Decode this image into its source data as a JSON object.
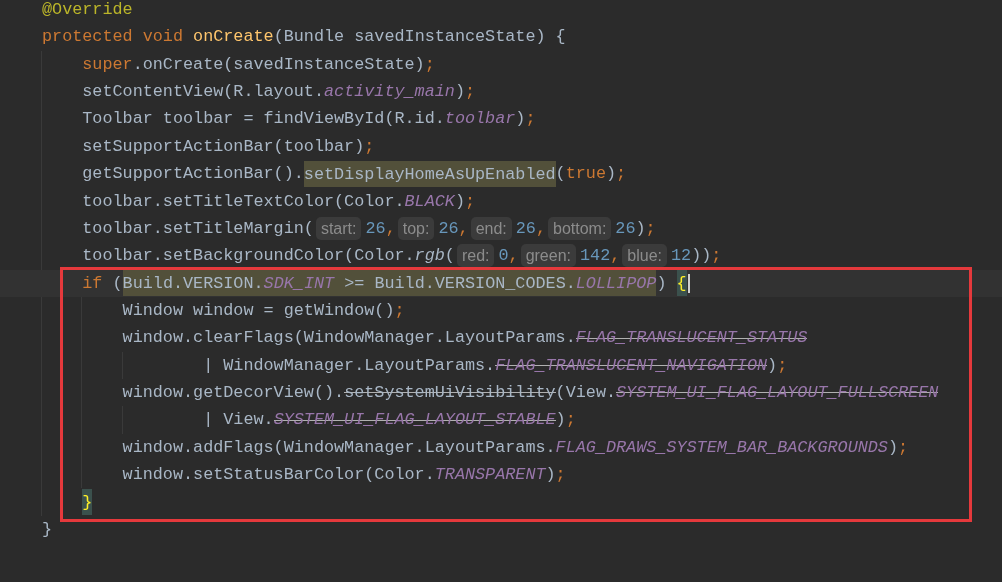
{
  "editor": {
    "lines": [
      {
        "kind": "code",
        "current": false,
        "tokens": [
          {
            "kind": "annotation",
            "text": "@Override"
          }
        ]
      },
      {
        "kind": "code",
        "current": false,
        "tokens": [
          {
            "kind": "keyword",
            "text": "protected void "
          },
          {
            "kind": "function",
            "text": "onCreate"
          },
          {
            "kind": "plain",
            "text": "(Bundle savedInstanceState) {"
          }
        ],
        "children": [
          {
            "kind": "code",
            "current": false,
            "tokens": [
              {
                "kind": "keyword",
                "text": "super"
              },
              {
                "kind": "plain",
                "text": ".onCreate(savedInstanceState)"
              },
              {
                "kind": "punct",
                "text": ";"
              }
            ]
          },
          {
            "kind": "code",
            "current": false,
            "tokens": [
              {
                "kind": "plain",
                "text": "setContentView(R.layout."
              },
              {
                "kind": "field",
                "text": "activity_main"
              },
              {
                "kind": "plain",
                "text": ")"
              },
              {
                "kind": "punct",
                "text": ";"
              }
            ]
          },
          {
            "kind": "code",
            "current": false,
            "tokens": [
              {
                "kind": "plain",
                "text": "Toolbar toolbar = findViewById(R.id."
              },
              {
                "kind": "field",
                "text": "toolbar"
              },
              {
                "kind": "plain",
                "text": ")"
              },
              {
                "kind": "punct",
                "text": ";"
              }
            ]
          },
          {
            "kind": "code",
            "current": false,
            "tokens": [
              {
                "kind": "plain",
                "text": "setSupportActionBar(toolbar)"
              },
              {
                "kind": "punct",
                "text": ";"
              }
            ]
          },
          {
            "kind": "code",
            "current": false,
            "tokens": [
              {
                "kind": "plain",
                "text": "getSupportActionBar()."
              },
              {
                "kind": "highlight",
                "tokens": [
                  {
                    "kind": "plain",
                    "text": "setDisplayHomeAsUpEnabled"
                  }
                ]
              },
              {
                "kind": "plain",
                "text": "("
              },
              {
                "kind": "keyword",
                "text": "true"
              },
              {
                "kind": "plain",
                "text": ")"
              },
              {
                "kind": "punct",
                "text": ";"
              }
            ]
          },
          {
            "kind": "code",
            "current": false,
            "tokens": [
              {
                "kind": "plain",
                "text": "toolbar.setTitleTextColor(Color."
              },
              {
                "kind": "field",
                "text": "BLACK"
              },
              {
                "kind": "plain",
                "text": ")"
              },
              {
                "kind": "punct",
                "text": ";"
              }
            ]
          },
          {
            "kind": "code",
            "current": false,
            "tokens": [
              {
                "kind": "plain",
                "text": "toolbar.setTitleMargin("
              },
              {
                "kind": "hint",
                "text": "start:"
              },
              {
                "kind": "number",
                "text": "26"
              },
              {
                "kind": "punct",
                "text": ","
              },
              {
                "kind": "hint",
                "text": "top:"
              },
              {
                "kind": "number",
                "text": "26"
              },
              {
                "kind": "punct",
                "text": ","
              },
              {
                "kind": "hint",
                "text": "end:"
              },
              {
                "kind": "number",
                "text": "26"
              },
              {
                "kind": "punct",
                "text": ","
              },
              {
                "kind": "hint",
                "text": "bottom:"
              },
              {
                "kind": "number",
                "text": "26"
              },
              {
                "kind": "plain",
                "text": ")"
              },
              {
                "kind": "punct",
                "text": ";"
              }
            ]
          },
          {
            "kind": "code",
            "current": false,
            "tokens": [
              {
                "kind": "plain",
                "text": "toolbar.setBackgroundColor(Color."
              },
              {
                "kind": "static_call",
                "text": "rgb"
              },
              {
                "kind": "plain",
                "text": "("
              },
              {
                "kind": "hint",
                "text": "red:"
              },
              {
                "kind": "number",
                "text": "0"
              },
              {
                "kind": "punct",
                "text": ","
              },
              {
                "kind": "hint",
                "text": "green:"
              },
              {
                "kind": "number",
                "text": "142"
              },
              {
                "kind": "punct",
                "text": ","
              },
              {
                "kind": "hint",
                "text": "blue:"
              },
              {
                "kind": "number",
                "text": "12"
              },
              {
                "kind": "plain",
                "text": "))"
              },
              {
                "kind": "punct",
                "text": ";"
              }
            ]
          },
          {
            "kind": "frame",
            "lines": [
              {
                "kind": "code",
                "current": true,
                "tokens": [
                  {
                    "kind": "keyword",
                    "text": "if"
                  },
                  {
                    "kind": "plain",
                    "text": " ("
                  },
                  {
                    "kind": "highlight",
                    "tokens": [
                      {
                        "kind": "plain",
                        "text": "Build.VERSION."
                      },
                      {
                        "kind": "field",
                        "text": "SDK_INT"
                      },
                      {
                        "kind": "plain",
                        "text": " >= Build.VERSION_CODES."
                      },
                      {
                        "kind": "field",
                        "text": "LOLLIPOP"
                      }
                    ]
                  },
                  {
                    "kind": "plain",
                    "text": ") "
                  },
                  {
                    "kind": "brace_match",
                    "text": "{"
                  }
                ],
                "children": [
                  {
                    "kind": "code",
                    "current": false,
                    "tokens": [
                      {
                        "kind": "plain",
                        "text": "Window window = getWindow()"
                      },
                      {
                        "kind": "punct",
                        "text": ";"
                      }
                    ]
                  },
                  {
                    "kind": "code",
                    "current": false,
                    "tokens": [
                      {
                        "kind": "plain",
                        "text": "window.clearFlags(WindowManager.LayoutParams."
                      },
                      {
                        "kind": "deprecated_field",
                        "text": "FLAG_TRANSLUCENT_STATUS"
                      }
                    ],
                    "continuation": [
                      {
                        "kind": "code",
                        "current": false,
                        "tokens": [
                          {
                            "kind": "plain",
                            "text": "| WindowManager.LayoutParams."
                          },
                          {
                            "kind": "deprecated_field",
                            "text": "FLAG_TRANSLUCENT_NAVIGATION"
                          },
                          {
                            "kind": "plain",
                            "text": ")"
                          },
                          {
                            "kind": "punct",
                            "text": ";"
                          }
                        ]
                      }
                    ]
                  },
                  {
                    "kind": "code",
                    "current": false,
                    "tokens": [
                      {
                        "kind": "plain",
                        "text": "window.getDecorView()."
                      },
                      {
                        "kind": "deprecated_call",
                        "text": "setSystemUiVisibility"
                      },
                      {
                        "kind": "plain",
                        "text": "(View."
                      },
                      {
                        "kind": "deprecated_field",
                        "text": "SYSTEM_UI_FLAG_LAYOUT_FULLSCREEN"
                      }
                    ],
                    "continuation": [
                      {
                        "kind": "code",
                        "current": false,
                        "tokens": [
                          {
                            "kind": "plain",
                            "text": "| View."
                          },
                          {
                            "kind": "deprecated_field",
                            "text": "SYSTEM_UI_FLAG_LAYOUT_STABLE"
                          },
                          {
                            "kind": "plain",
                            "text": ")"
                          },
                          {
                            "kind": "punct",
                            "text": ";"
                          }
                        ]
                      }
                    ]
                  },
                  {
                    "kind": "code",
                    "current": false,
                    "tokens": [
                      {
                        "kind": "plain",
                        "text": "window.addFlags(WindowManager.LayoutParams."
                      },
                      {
                        "kind": "field",
                        "text": "FLAG_DRAWS_SYSTEM_BAR_BACKGROUNDS"
                      },
                      {
                        "kind": "plain",
                        "text": ")"
                      },
                      {
                        "kind": "punct",
                        "text": ";"
                      }
                    ]
                  },
                  {
                    "kind": "code",
                    "current": false,
                    "tokens": [
                      {
                        "kind": "plain",
                        "text": "window.setStatusBarColor(Color."
                      },
                      {
                        "kind": "field",
                        "text": "TRANSPARENT"
                      },
                      {
                        "kind": "plain",
                        "text": ")"
                      },
                      {
                        "kind": "punct",
                        "text": ";"
                      }
                    ]
                  }
                ]
              },
              {
                "kind": "code",
                "current": false,
                "tokens": [
                  {
                    "kind": "brace_match",
                    "text": "}"
                  }
                ]
              }
            ]
          }
        ]
      },
      {
        "kind": "code",
        "current": false,
        "tokens": [
          {
            "kind": "plain",
            "text": "}"
          }
        ]
      }
    ]
  }
}
